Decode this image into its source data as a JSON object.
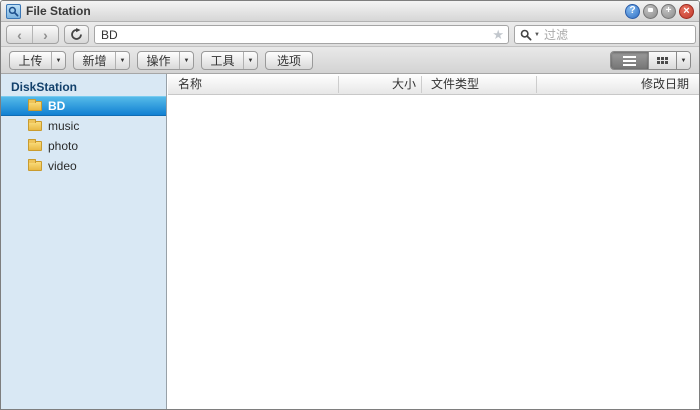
{
  "window": {
    "title": "File Station",
    "controls": {
      "help_glyph": "?",
      "maximize_glyph": "+",
      "close_glyph": "×"
    }
  },
  "navbar": {
    "back_glyph": "‹",
    "forward_glyph": "›",
    "path_value": "BD",
    "star_glyph": "★",
    "search_placeholder": "过滤",
    "search_caret_glyph": "▼"
  },
  "toolbar": {
    "buttons": [
      {
        "label": "上传",
        "dropdown": true
      },
      {
        "label": "新增",
        "dropdown": true
      },
      {
        "label": "操作",
        "dropdown": true
      },
      {
        "label": "工具",
        "dropdown": true
      },
      {
        "label": "选项",
        "dropdown": false
      }
    ],
    "dropdown_glyph": "▼",
    "view_mode": "list"
  },
  "sidebar": {
    "root_label": "DiskStation",
    "items": [
      {
        "label": "BD",
        "selected": true
      },
      {
        "label": "music",
        "selected": false
      },
      {
        "label": "photo",
        "selected": false
      },
      {
        "label": "video",
        "selected": false
      }
    ]
  },
  "filelist": {
    "columns": [
      "名称",
      "大小",
      "文件类型",
      "修改日期"
    ],
    "rows": []
  },
  "colors": {
    "selection_top": "#55bae9",
    "selection_bottom": "#1180d2",
    "sidebar_bg": "#d9e8f4",
    "folder_yellow": "#e9b944",
    "help_button_blue": "#2f6fc4",
    "close_button_red": "#c03a2c"
  }
}
